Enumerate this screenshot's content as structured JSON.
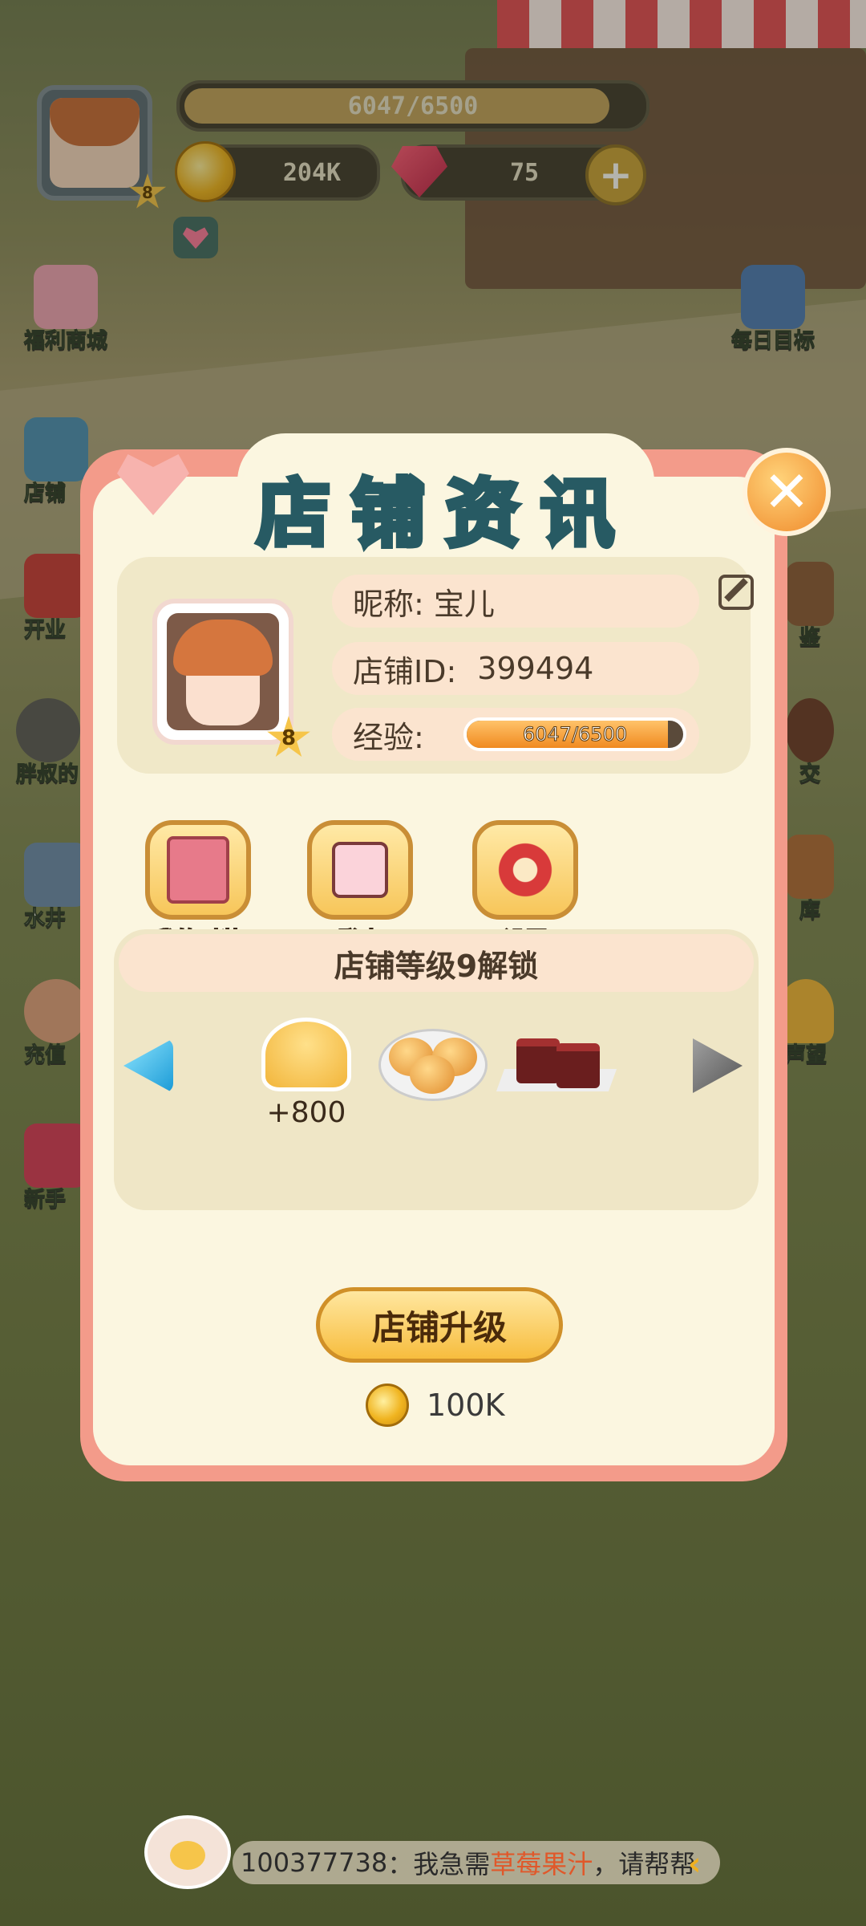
{
  "hud": {
    "level": "8",
    "exp_bar": "6047/6500",
    "exp_progress": 0.93,
    "coins": "204K",
    "gems": "75",
    "plus": "+"
  },
  "side_left": [
    {
      "label": "福利商城"
    },
    {
      "label": "店铺"
    },
    {
      "label": "开业"
    },
    {
      "label": "胖叔的"
    },
    {
      "label": "水井"
    },
    {
      "label": "充值"
    },
    {
      "label": "新手"
    }
  ],
  "side_right": [
    {
      "label": "每日目标"
    },
    {
      "label": "鉴"
    },
    {
      "label": "交"
    },
    {
      "label": "库"
    },
    {
      "label": "声望"
    }
  ],
  "dialog": {
    "title": "店铺资讯",
    "close": "✕",
    "profile": {
      "level": "8",
      "nickname_label": "昵称:",
      "nickname": "宝儿",
      "shop_id_label": "店铺ID:",
      "shop_id": "399494",
      "exp_label": "经验:",
      "exp_value": "6047/6500",
      "exp_progress": 0.93
    },
    "actions": [
      {
        "label": "我的时装",
        "icon": "wardrobe-icon"
      },
      {
        "label": "登出",
        "icon": "logout-icon"
      },
      {
        "label": "设置",
        "icon": "gear-icon"
      }
    ],
    "unlock": {
      "title": "店铺等级9解锁",
      "reward_amount": "+800",
      "items": [
        "muffin-icon",
        "buns-plate-icon",
        "cake-tray-icon"
      ]
    },
    "upgrade_label": "店铺升级",
    "upgrade_cost": "100K"
  },
  "chat": {
    "user": "100377738",
    "prefix": "：我急需",
    "highlight": "草莓果汁",
    "suffix": "，请帮帮"
  },
  "colors": {
    "title": "#5ec8d2",
    "dialog_border": "#f39b8a",
    "panel": "#fbf6e0",
    "button": "#f7c65a"
  }
}
